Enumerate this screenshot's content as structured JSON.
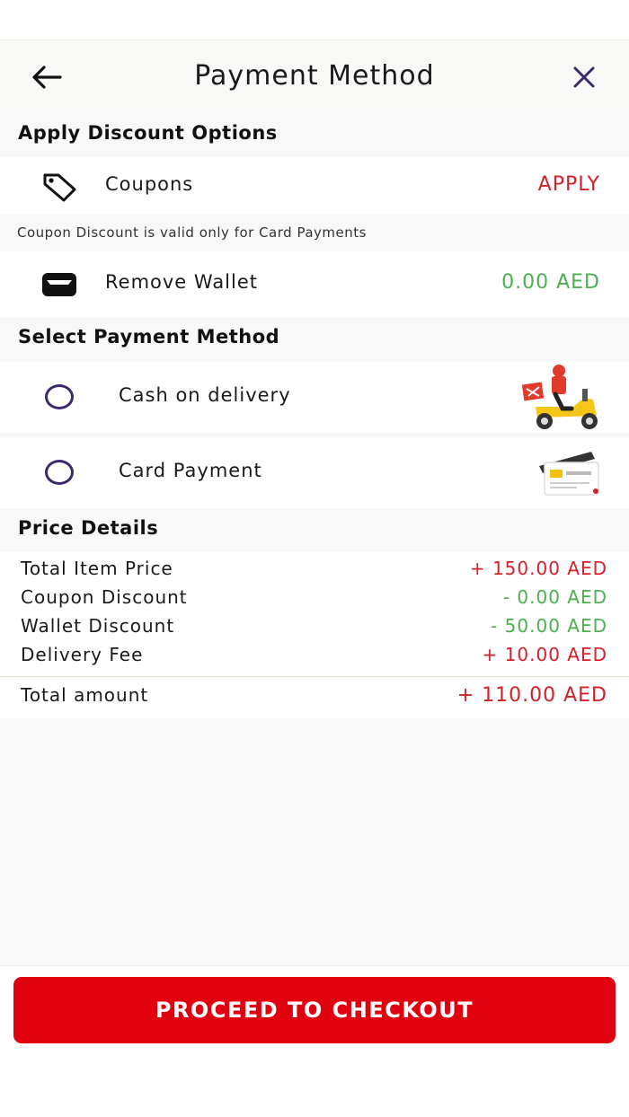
{
  "header": {
    "title": "Payment Method"
  },
  "discount": {
    "heading": "Apply Discount Options",
    "coupons_label": "Coupons",
    "apply_label": "APPLY",
    "note": "Coupon Discount is valid only for Card Payments",
    "wallet_label": "Remove Wallet",
    "wallet_amount": "0.00 AED"
  },
  "payment": {
    "heading": "Select Payment Method",
    "options": [
      {
        "label": "Cash on delivery",
        "icon": "delivery-scooter-icon",
        "selected": false
      },
      {
        "label": "Card Payment",
        "icon": "credit-card-icon",
        "selected": false
      }
    ]
  },
  "price_details": {
    "heading": "Price Details",
    "rows": [
      {
        "label": "Total Item Price",
        "value": "+ 150.00 AED"
      },
      {
        "label": "Coupon Discount",
        "value": "- 0.00 AED"
      },
      {
        "label": "Wallet Discount",
        "value": "- 50.00 AED"
      },
      {
        "label": "Delivery Fee",
        "value": "+ 10.00 AED"
      }
    ],
    "total_label": "Total amount",
    "total_value": "+ 110.00 AED"
  },
  "checkout": {
    "label": "PROCEED TO CHECKOUT"
  },
  "colors": {
    "accent_red": "#e0020f",
    "price_red": "#d3202a",
    "green": "#4caf50",
    "radio": "#3d2a6b",
    "close": "#3d2a6b"
  }
}
